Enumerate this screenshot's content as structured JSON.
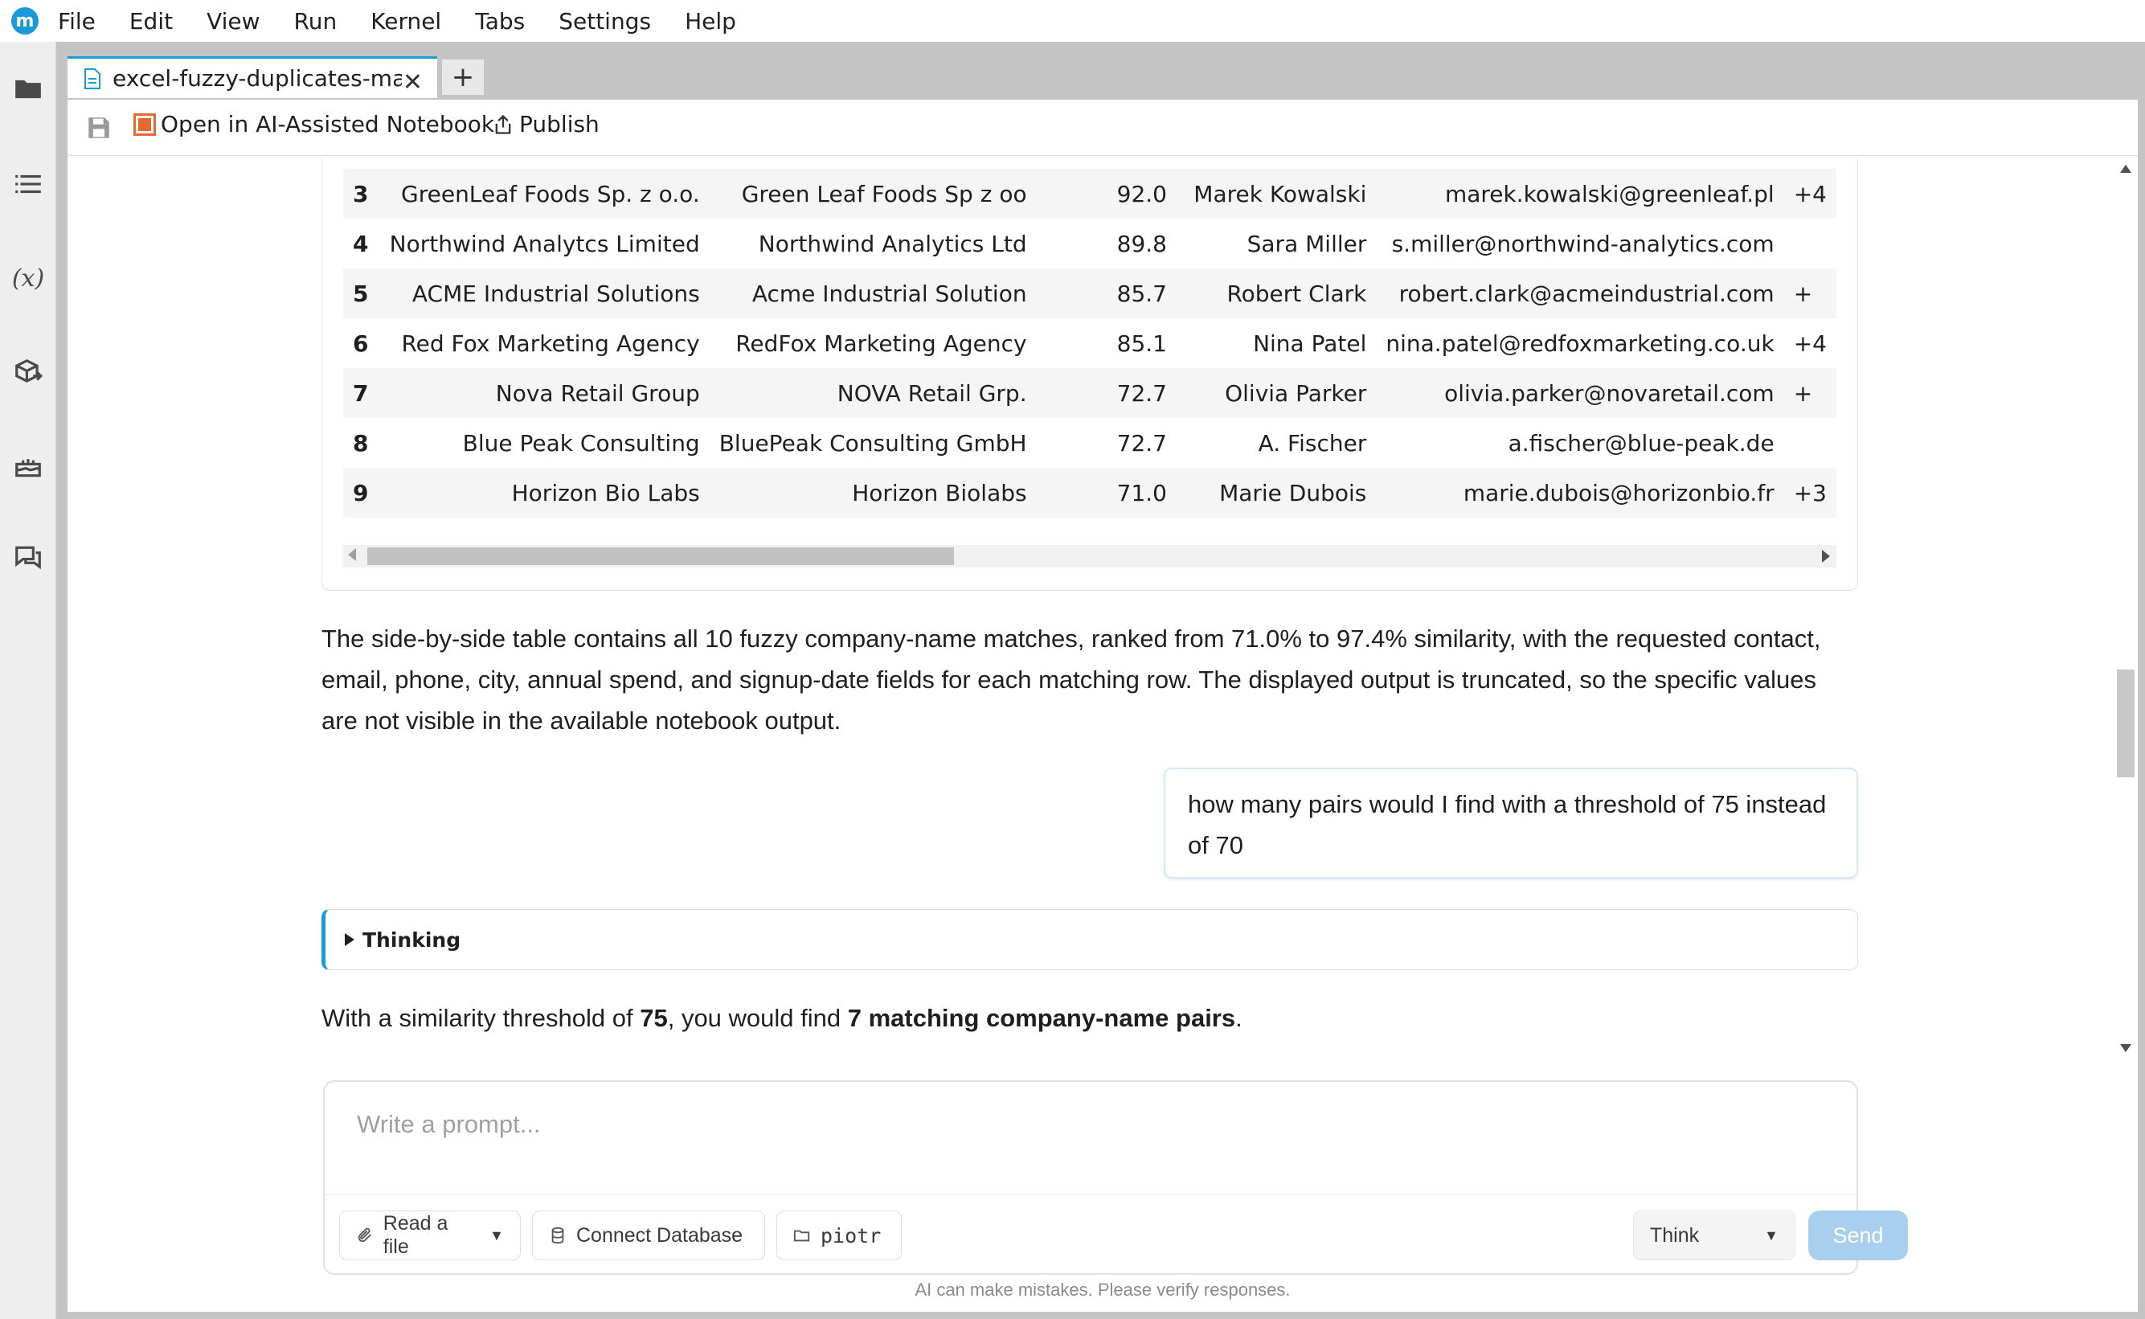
{
  "menubar": {
    "logo": "m",
    "items": [
      "File",
      "Edit",
      "View",
      "Run",
      "Kernel",
      "Tabs",
      "Settings",
      "Help"
    ]
  },
  "sidebar": {
    "icons": [
      "folder-icon",
      "list-icon",
      "variables-icon",
      "package-icon",
      "cake-icon",
      "chat-icon"
    ],
    "variables_glyph": "(x)"
  },
  "tabs": {
    "active_label": "excel-fuzzy-duplicates-match",
    "new_tab": "+"
  },
  "toolbar": {
    "open_ai_label": "Open in AI-Assisted Notebook",
    "publish_label": "Publish"
  },
  "table": {
    "rows": [
      {
        "idx": "3",
        "name_a": "GreenLeaf Foods Sp. z o.o.",
        "name_b": "Green Leaf Foods Sp z oo",
        "score": "92.0",
        "contact": "Marek Kowalski",
        "email": "marek.kowalski@greenleaf.pl",
        "phone": "+4"
      },
      {
        "idx": "4",
        "name_a": "Northwind Analytcs Limited",
        "name_b": "Northwind Analytics Ltd",
        "score": "89.8",
        "contact": "Sara Miller",
        "email": "s.miller@northwind-analytics.com",
        "phone": ""
      },
      {
        "idx": "5",
        "name_a": "ACME Industrial Solutions",
        "name_b": "Acme Industrial Solution",
        "score": "85.7",
        "contact": "Robert Clark",
        "email": "robert.clark@acmeindustrial.com",
        "phone": "+"
      },
      {
        "idx": "6",
        "name_a": "Red Fox Marketing Agency",
        "name_b": "RedFox Marketing Agency",
        "score": "85.1",
        "contact": "Nina Patel",
        "email": "nina.patel@redfoxmarketing.co.uk",
        "phone": "+4"
      },
      {
        "idx": "7",
        "name_a": "Nova Retail Group",
        "name_b": "NOVA Retail Grp.",
        "score": "72.7",
        "contact": "Olivia Parker",
        "email": "olivia.parker@novaretail.com",
        "phone": "+"
      },
      {
        "idx": "8",
        "name_a": "Blue Peak Consulting",
        "name_b": "BluePeak Consulting GmbH",
        "score": "72.7",
        "contact": "A. Fischer",
        "email": "a.fischer@blue-peak.de",
        "phone": ""
      },
      {
        "idx": "9",
        "name_a": "Horizon Bio Labs",
        "name_b": "Horizon Biolabs",
        "score": "71.0",
        "contact": "Marie Dubois",
        "email": "marie.dubois@horizonbio.fr",
        "phone": "+3"
      }
    ]
  },
  "chat": {
    "summary": "The side-by-side table contains all 10 fuzzy company-name matches, ranked from 71.0% to 97.4% similarity, with the requested contact, email, phone, city, annual spend, and signup-date fields for each matching row. The displayed output is truncated, so the specific values are not visible in the available notebook output.",
    "user_message": "how many pairs would I find with a threshold of 75 instead of 70",
    "thinking_label": "Thinking",
    "answer_prefix": "With a similarity threshold of ",
    "answer_threshold": "75",
    "answer_middle": ", you would find ",
    "answer_result": "7 matching company-name pairs",
    "answer_suffix": "."
  },
  "prompt": {
    "placeholder": "Write a prompt...",
    "read_file_label": "Read a file",
    "connect_db_label": "Connect Database",
    "directory_label": "piotr",
    "mode_label": "Think",
    "send_label": "Send",
    "disclaimer": "AI can make mistakes. Please verify responses."
  },
  "colors": {
    "accent": "#1a9bd7",
    "ai_icon": "#e8692e",
    "send_disabled": "#a9cfee"
  }
}
